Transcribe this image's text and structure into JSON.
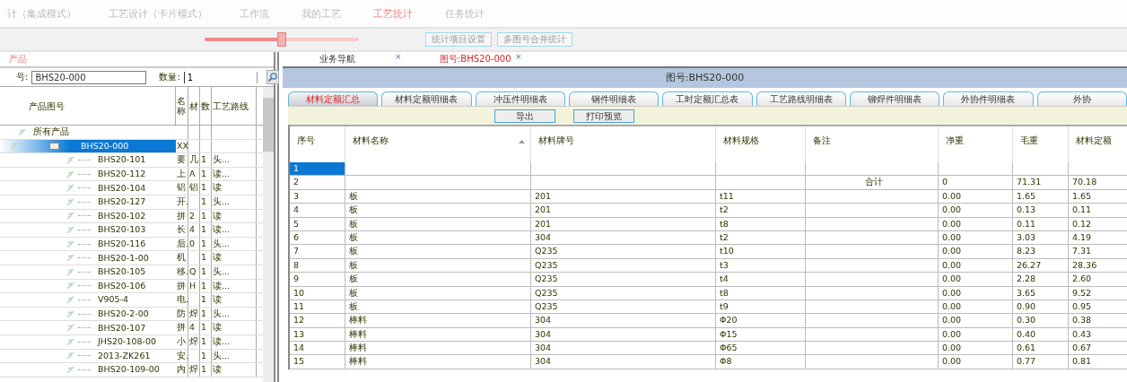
{
  "menu": [
    {
      "label": "计（集成模式）",
      "selected": false
    },
    {
      "label": "工艺设计（卡片模式）",
      "selected": false
    },
    {
      "label": "工作流",
      "selected": false
    },
    {
      "label": "我的工艺",
      "selected": false
    },
    {
      "label": "工艺统计",
      "selected": true
    },
    {
      "label": "任务统计",
      "selected": false
    }
  ],
  "zoom_slider": {
    "level": 0.5
  },
  "toolbar_buttons": [
    "统计项目设置",
    "多图号合并统计"
  ],
  "product_panel": {
    "title": "产品",
    "drawing_label": "号:",
    "drawing_value": "BHS20-000",
    "qty_label": "数量:",
    "qty_value": "1",
    "tree": {
      "columns": [
        "产品图号",
        "名称",
        "材",
        "数",
        "工艺路线"
      ],
      "nodes": [
        {
          "label": "所有产品",
          "selected": false,
          "children": [
            {
              "label": "BHS20-000",
              "cells": [
                "XX",
                "",
                "",
                ""
              ],
              "selected": true,
              "children": [
                {
                  "label": "BHS20-101",
                  "cells": [
                    "要",
                    "几",
                    "1",
                    "头..."
                  ],
                  "selected": false
                },
                {
                  "label": "BHS20-112",
                  "cells": [
                    "上",
                    "A",
                    "1",
                    "读..."
                  ],
                  "selected": false
                },
                {
                  "label": "BHS20-104",
                  "cells": [
                    "铝",
                    "铝",
                    "1",
                    "读"
                  ],
                  "selected": false
                },
                {
                  "label": "BHS20-127",
                  "cells": [
                    "开.",
                    "",
                    "1",
                    "头..."
                  ],
                  "selected": false
                },
                {
                  "label": "BHS20-102",
                  "cells": [
                    "拼",
                    "2",
                    "1",
                    "读"
                  ],
                  "selected": false
                },
                {
                  "label": "BHS20-103",
                  "cells": [
                    "长",
                    "4",
                    "1",
                    "读..."
                  ],
                  "selected": false
                },
                {
                  "label": "BHS20-116",
                  "cells": [
                    "后.",
                    "0",
                    "1",
                    "头..."
                  ],
                  "selected": false
                },
                {
                  "label": "BHS20-1-00",
                  "cells": [
                    "机",
                    "",
                    "1",
                    "读"
                  ],
                  "selected": false
                },
                {
                  "label": "BHS20-105",
                  "cells": [
                    "移.",
                    "Q",
                    "1",
                    "头..."
                  ],
                  "selected": false
                },
                {
                  "label": "BHS20-106",
                  "cells": [
                    "拼",
                    "H",
                    "1",
                    "读..."
                  ],
                  "selected": false
                },
                {
                  "label": "V905-4",
                  "cells": [
                    "电.",
                    "",
                    "1",
                    "读"
                  ],
                  "selected": false
                },
                {
                  "label": "BHS20-2-00",
                  "cells": [
                    "防",
                    "焊",
                    "1",
                    "头..."
                  ],
                  "selected": false
                },
                {
                  "label": "BHS20-107",
                  "cells": [
                    "拼",
                    "4",
                    "1",
                    "读"
                  ],
                  "selected": false
                },
                {
                  "label": "JHS20-108-00",
                  "cells": [
                    "小",
                    "焊",
                    "1",
                    "读..."
                  ],
                  "selected": false
                },
                {
                  "label": "2013-ZK261",
                  "cells": [
                    "安.",
                    "",
                    "1",
                    "头..."
                  ],
                  "selected": false
                },
                {
                  "label": "BHS20-109-00",
                  "cells": [
                    "内",
                    "焊",
                    "1",
                    "读"
                  ],
                  "selected": false
                }
              ]
            }
          ]
        }
      ]
    }
  },
  "doc_tabs": [
    {
      "label": "业务导航",
      "close": "×",
      "selected": false
    },
    {
      "label": "图号:BHS20-000",
      "close": "×",
      "selected": true
    }
  ],
  "report": {
    "title": "图号:BHS20-000",
    "tabs": [
      {
        "label": "材料定额汇总",
        "selected": true
      },
      {
        "label": "材料定额明细表",
        "selected": false
      },
      {
        "label": "冲压件明细表",
        "selected": false
      },
      {
        "label": "钢件明细表",
        "selected": false
      },
      {
        "label": "工时定额汇总表",
        "selected": false
      },
      {
        "label": "工艺路线明细表",
        "selected": false
      },
      {
        "label": "铆焊件明细表",
        "selected": false
      },
      {
        "label": "外协件明细表",
        "selected": false
      },
      {
        "label": "外协",
        "selected": false
      }
    ],
    "buttons": [
      "导出",
      "打印预览"
    ],
    "table": {
      "columns": [
        "序号",
        "材料名称",
        "材料牌号",
        "材料规格",
        "备注",
        "净重",
        "毛重",
        "材料定额"
      ],
      "rows": [
        {
          "selected": true,
          "cells": [
            "1",
            "",
            "",
            "",
            "",
            "",
            "",
            ""
          ]
        },
        {
          "selected": false,
          "cells": [
            "2",
            "",
            "",
            "",
            "合计",
            "0",
            "71.31",
            "70.18"
          ]
        },
        {
          "selected": false,
          "cells": [
            "3",
            "板",
            "201",
            "t11",
            "",
            "0.00",
            "1.65",
            "1.65"
          ]
        },
        {
          "selected": false,
          "cells": [
            "4",
            "板",
            "201",
            "t2",
            "",
            "0.00",
            "0.13",
            "0.11"
          ]
        },
        {
          "selected": false,
          "cells": [
            "5",
            "板",
            "201",
            "t8",
            "",
            "0.00",
            "0.11",
            "0.12"
          ]
        },
        {
          "selected": false,
          "cells": [
            "6",
            "板",
            "304",
            "t2",
            "",
            "0.00",
            "3.03",
            "4.19"
          ]
        },
        {
          "selected": false,
          "cells": [
            "7",
            "板",
            "Q235",
            "t10",
            "",
            "0.00",
            "8.23",
            "7.31"
          ]
        },
        {
          "selected": false,
          "cells": [
            "8",
            "板",
            "Q235",
            "t3",
            "",
            "0.00",
            "26.27",
            "28.36"
          ]
        },
        {
          "selected": false,
          "cells": [
            "9",
            "板",
            "Q235",
            "t4",
            "",
            "0.00",
            "2.28",
            "2.60"
          ]
        },
        {
          "selected": false,
          "cells": [
            "10",
            "板",
            "Q235",
            "t8",
            "",
            "0.00",
            "3.65",
            "9.52"
          ]
        },
        {
          "selected": false,
          "cells": [
            "11",
            "板",
            "Q235",
            "t9",
            "",
            "0.00",
            "0.90",
            "0.95"
          ]
        },
        {
          "selected": false,
          "cells": [
            "12",
            "棒料",
            "304",
            "Φ20",
            "",
            "0.00",
            "0.30",
            "0.38"
          ]
        },
        {
          "selected": false,
          "cells": [
            "13",
            "棒料",
            "304",
            "Φ15",
            "",
            "0.00",
            "0.40",
            "0.43"
          ]
        },
        {
          "selected": false,
          "cells": [
            "14",
            "棒料",
            "304",
            "Φ65",
            "",
            "0.00",
            "0.61",
            "0.67"
          ]
        },
        {
          "selected": false,
          "cells": [
            "15",
            "棒料",
            "304",
            "Φ8",
            "",
            "0.00",
            "0.77",
            "0.81"
          ]
        }
      ]
    }
  }
}
